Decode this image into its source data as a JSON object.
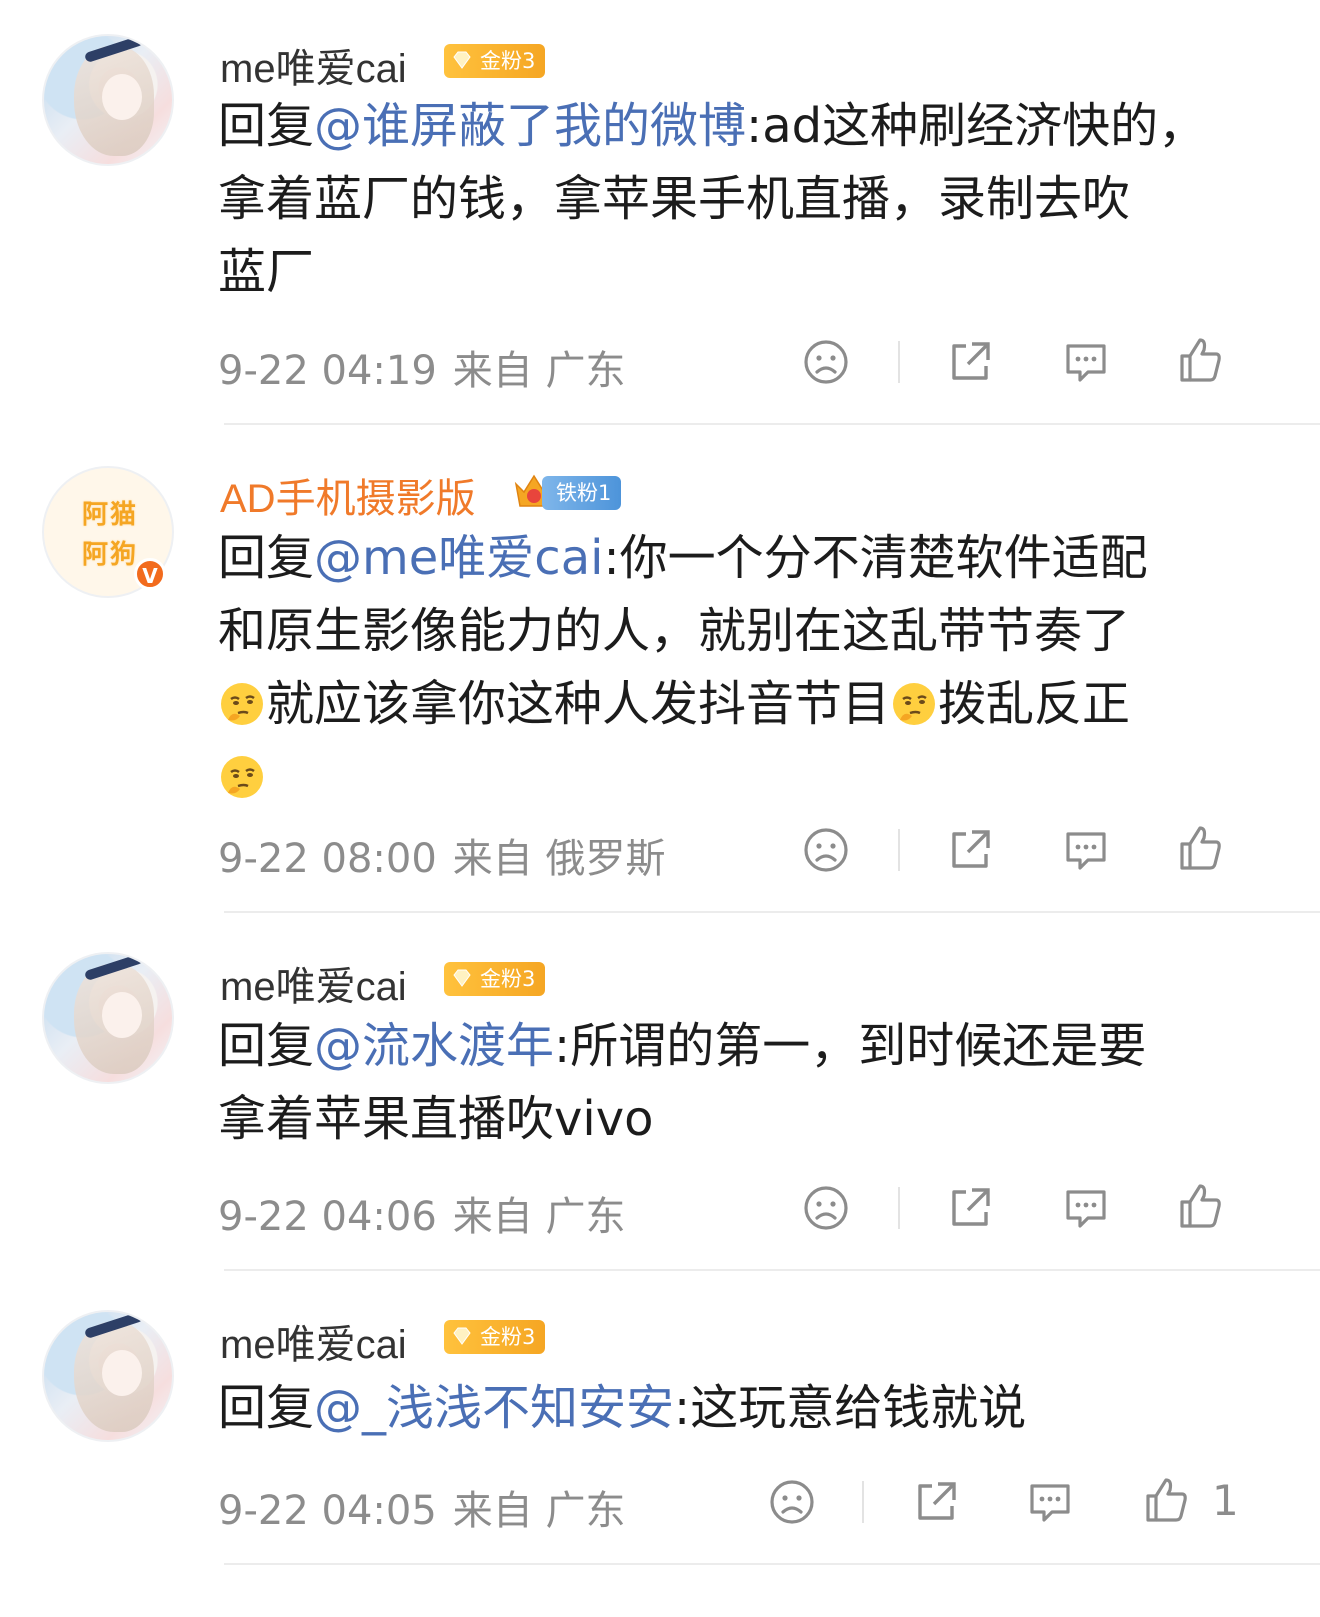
{
  "comments": [
    {
      "username": "me唯爱cai",
      "badge": "金粉3",
      "reply_prefix": "回复",
      "mention": "@谁屏蔽了我的微博",
      "line1_rest": ":ad这种刷经济快的，",
      "line2": "拿着蓝厂的钱，拿苹果手机直播，录制去吹",
      "line3": "蓝厂",
      "time": "9-22 04:19",
      "source": "来自 广东"
    },
    {
      "username": "AD手机摄影版",
      "badge": "铁粉1",
      "avatar_text_top": "阿猫",
      "avatar_text_bottom": "阿狗",
      "verified": "V",
      "reply_prefix": "回复",
      "mention": "@me唯爱cai",
      "line1_rest": ":你一个分不清楚软件适配",
      "line2": "和原生影像能力的人，就别在这乱带节奏了",
      "line3_a": "就应该拿你这种人发抖音节目",
      "line3_b": "拨乱反正",
      "time": "9-22 08:00",
      "source": "来自 俄罗斯"
    },
    {
      "username": "me唯爱cai",
      "badge": "金粉3",
      "reply_prefix": "回复",
      "mention": "@流水渡年",
      "line1_rest": ":所谓的第一，到时候还是要",
      "line2": "拿着苹果直播吹vivo",
      "time": "9-22 04:06",
      "source": "来自 广东"
    },
    {
      "username": "me唯爱cai",
      "badge": "金粉3",
      "reply_prefix": "回复",
      "mention": "@_浅浅不知安安",
      "line1_rest": ":这玩意给钱就说",
      "time": "9-22 04:05",
      "source": "来自 广东",
      "like_count": "1"
    }
  ],
  "icons": {
    "dislike": "frown-icon",
    "share": "share-icon",
    "comment": "comment-icon",
    "like": "thumbs-up-icon",
    "emoji": "thinking-face-emoji"
  },
  "colors": {
    "mention": "#4a6fb5",
    "username_highlight": "#f07a2a",
    "meta": "#8c8c8c",
    "gold_badge": "#f5a623",
    "iron_badge": "#4d94da"
  }
}
